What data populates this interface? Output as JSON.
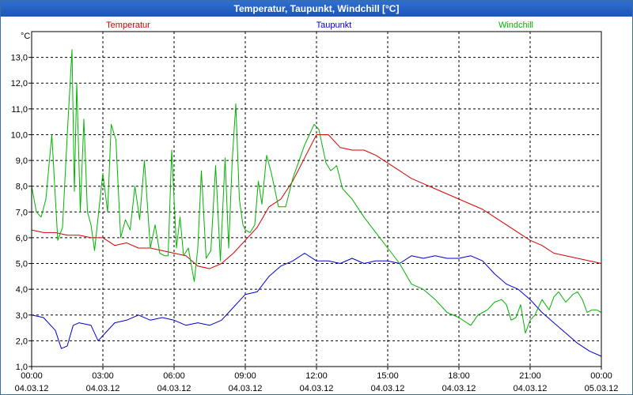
{
  "window": {
    "title": "Temperatur, Taupunkt, Windchill [°C]"
  },
  "chart_data": {
    "type": "line",
    "title": "Temperatur, Taupunkt, Windchill [°C]",
    "ylabel": "°C",
    "ylim": [
      1,
      14
    ],
    "xlim": [
      0,
      24
    ],
    "grid": true,
    "legend_position": "top",
    "y_ticks": [
      "1,0",
      "2,0",
      "3,0",
      "4,0",
      "5,0",
      "6,0",
      "7,0",
      "8,0",
      "9,0",
      "10,0",
      "11,0",
      "12,0",
      "13,0"
    ],
    "x_ticks": [
      {
        "time": "00:00",
        "date": "04.03.12"
      },
      {
        "time": "03:00",
        "date": "04.03.12"
      },
      {
        "time": "06:00",
        "date": "04.03.12"
      },
      {
        "time": "09:00",
        "date": "04.03.12"
      },
      {
        "time": "12:00",
        "date": "04.03.12"
      },
      {
        "time": "15:00",
        "date": "04.03.12"
      },
      {
        "time": "18:00",
        "date": "04.03.12"
      },
      {
        "time": "21:00",
        "date": "04.03.12"
      },
      {
        "time": "00:00",
        "date": "05.03.12"
      }
    ],
    "series": [
      {
        "name": "Temperatur",
        "color": "#d40000",
        "x": [
          0,
          0.5,
          1,
          1.5,
          2,
          2.5,
          3,
          3.5,
          4,
          4.5,
          5,
          5.5,
          6,
          6.5,
          7,
          7.5,
          8,
          8.5,
          9,
          9.5,
          10,
          10.5,
          11,
          11.5,
          12,
          12.5,
          13,
          13.5,
          14,
          14.5,
          15,
          15.5,
          16,
          16.5,
          17,
          17.5,
          18,
          18.5,
          19,
          19.5,
          20,
          20.5,
          21,
          21.5,
          22,
          22.5,
          23,
          23.5,
          24
        ],
        "values": [
          6.3,
          6.2,
          6.2,
          6.1,
          6.1,
          6.0,
          6.0,
          5.7,
          5.8,
          5.6,
          5.6,
          5.5,
          5.4,
          5.3,
          4.9,
          4.8,
          5.0,
          5.4,
          5.9,
          6.4,
          7.2,
          7.5,
          8.2,
          9.1,
          10.0,
          10.0,
          9.5,
          9.4,
          9.4,
          9.2,
          8.9,
          8.6,
          8.3,
          8.1,
          7.9,
          7.7,
          7.5,
          7.3,
          7.1,
          6.8,
          6.5,
          6.2,
          5.9,
          5.7,
          5.4,
          5.3,
          5.2,
          5.1,
          5.0
        ]
      },
      {
        "name": "Taupunkt",
        "color": "#0000c8",
        "x": [
          0,
          0.5,
          1,
          1.25,
          1.5,
          1.75,
          2,
          2.5,
          2.8,
          3,
          3.5,
          4,
          4.5,
          5,
          5.5,
          6,
          6.5,
          7,
          7.5,
          8,
          8.5,
          9,
          9.5,
          10,
          10.5,
          11,
          11.5,
          12,
          12.5,
          13,
          13.5,
          14,
          14.5,
          15,
          15.5,
          16,
          16.5,
          17,
          17.5,
          18,
          18.5,
          19,
          19.5,
          20,
          20.5,
          21,
          21.5,
          22,
          22.5,
          23,
          23.5,
          24
        ],
        "values": [
          3.0,
          2.9,
          2.4,
          1.7,
          1.8,
          2.6,
          2.7,
          2.6,
          2.0,
          2.2,
          2.7,
          2.8,
          3.0,
          2.8,
          2.9,
          2.8,
          2.6,
          2.7,
          2.6,
          2.8,
          3.3,
          3.8,
          3.9,
          4.5,
          4.9,
          5.1,
          5.4,
          5.1,
          5.1,
          5.0,
          5.2,
          5.0,
          5.1,
          5.1,
          5.0,
          5.3,
          5.2,
          5.3,
          5.2,
          5.2,
          5.3,
          5.1,
          4.6,
          4.2,
          4.0,
          3.6,
          3.1,
          2.7,
          2.3,
          1.9,
          1.6,
          1.4
        ]
      },
      {
        "name": "Windchill",
        "color": "#00b400",
        "x": [
          0,
          0.2,
          0.4,
          0.6,
          0.85,
          1.1,
          1.3,
          1.5,
          1.7,
          1.8,
          1.9,
          2.05,
          2.2,
          2.35,
          2.5,
          2.65,
          2.8,
          3.0,
          3.2,
          3.35,
          3.55,
          3.75,
          3.95,
          4.15,
          4.35,
          4.55,
          4.75,
          5.0,
          5.2,
          5.4,
          5.6,
          5.75,
          5.9,
          6.1,
          6.25,
          6.4,
          6.6,
          6.85,
          7.0,
          7.15,
          7.35,
          7.55,
          7.75,
          7.95,
          8.15,
          8.3,
          8.45,
          8.6,
          8.75,
          8.9,
          9.0,
          9.2,
          9.4,
          9.55,
          9.7,
          9.9,
          10.1,
          10.4,
          10.7,
          11.0,
          11.5,
          11.9,
          12.1,
          12.4,
          12.6,
          12.85,
          13.1,
          13.5,
          14.0,
          14.5,
          15.0,
          15.5,
          16.0,
          16.5,
          17.0,
          17.5,
          18.0,
          18.5,
          18.8,
          19.0,
          19.2,
          19.5,
          19.8,
          20.0,
          20.2,
          20.4,
          20.6,
          20.8,
          21.0,
          21.2,
          21.5,
          21.8,
          22.0,
          22.2,
          22.5,
          22.8,
          23.0,
          23.2,
          23.4,
          23.6,
          23.8,
          24.0
        ],
        "values": [
          8.0,
          7.0,
          6.8,
          7.5,
          10.0,
          5.9,
          6.4,
          10.0,
          13.3,
          7.8,
          12.0,
          7.0,
          10.6,
          7.0,
          6.5,
          5.5,
          6.8,
          8.5,
          7.0,
          10.4,
          9.8,
          6.0,
          6.7,
          6.3,
          8.0,
          6.7,
          9.0,
          5.6,
          6.5,
          5.4,
          5.3,
          5.3,
          9.4,
          5.6,
          6.8,
          5.3,
          5.6,
          4.3,
          5.6,
          8.6,
          5.2,
          5.5,
          8.8,
          5.1,
          9.1,
          5.6,
          9.0,
          11.2,
          7.5,
          6.5,
          6.3,
          6.2,
          6.5,
          8.2,
          7.3,
          9.2,
          8.5,
          7.2,
          7.2,
          8.3,
          9.6,
          10.4,
          10.2,
          8.9,
          8.6,
          8.8,
          7.9,
          7.5,
          6.8,
          6.2,
          5.6,
          5.0,
          4.2,
          4.0,
          3.6,
          3.1,
          2.9,
          2.6,
          3.0,
          3.1,
          3.2,
          3.5,
          3.6,
          3.4,
          2.8,
          2.9,
          3.4,
          2.3,
          2.8,
          3.0,
          3.6,
          3.2,
          3.7,
          3.9,
          3.5,
          3.8,
          3.9,
          3.6,
          3.1,
          3.2,
          3.2,
          3.1
        ]
      }
    ]
  }
}
